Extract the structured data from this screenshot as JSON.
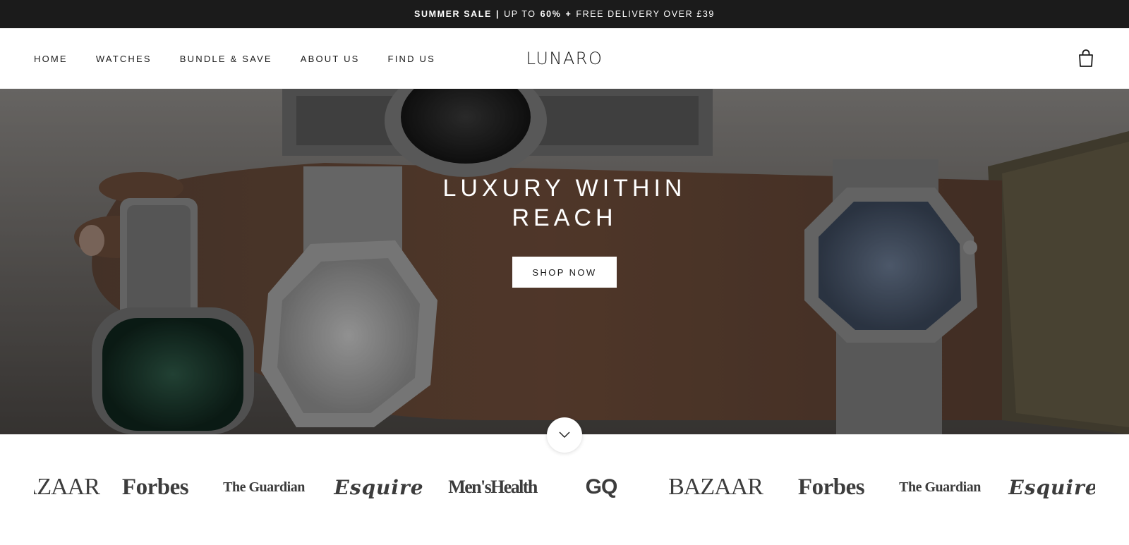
{
  "announcement": {
    "bold": "SUMMER SALE",
    "separator": "|",
    "text_a": "UP TO",
    "percent": "60%",
    "plus": "+",
    "text_b": "FREE DELIVERY OVER £39"
  },
  "header": {
    "nav": [
      "HOME",
      "WATCHES",
      "BUNDLE & SAVE",
      "ABOUT US",
      "FIND US"
    ],
    "logo": "LUNARO",
    "cart_icon": "shopping-bag-icon"
  },
  "hero": {
    "title_line1": "LUXURY WITHIN",
    "title_line2": "REACH",
    "cta": "SHOP NOW",
    "scroll_icon": "chevron-down-icon"
  },
  "press": {
    "logos": [
      "BAZAAR",
      "Forbes",
      "The Guardian",
      "Esquire",
      "Men'sHealth",
      "GQ",
      "BAZAAR",
      "Forbes",
      "The Guardian",
      "Esquire"
    ]
  },
  "colors": {
    "announcement_bg": "#1b1b1b",
    "text": "#1a1a1a",
    "press_logo": "#3c3c3c"
  }
}
